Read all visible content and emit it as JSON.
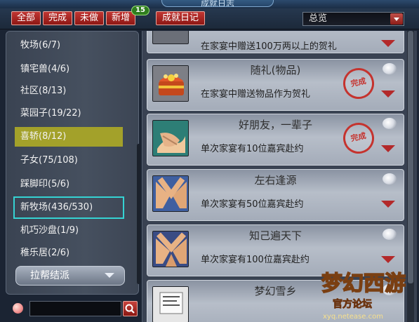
{
  "window": {
    "title": "成就日志"
  },
  "toolbar": {
    "all": "全部",
    "done": "完成",
    "undone": "未做",
    "new": "新增",
    "new_count": "15",
    "log": "成就日记",
    "overview_value": "总览"
  },
  "sidebar": {
    "items": [
      {
        "label": "牧场(6/7)"
      },
      {
        "label": "镇宅兽(4/6)"
      },
      {
        "label": "社区(8/13)"
      },
      {
        "label": "菜园子(19/22)"
      },
      {
        "label": "喜轿(8/12)"
      },
      {
        "label": "子女(75/108)"
      },
      {
        "label": "踩脚印(5/6)"
      },
      {
        "label": "新牧场(436/530)"
      },
      {
        "label": "机巧沙盘(1/9)"
      },
      {
        "label": "稚乐居(2/6)"
      }
    ],
    "guild_label": "拉帮结派"
  },
  "search": {
    "placeholder": ""
  },
  "achievements": [
    {
      "title": "",
      "desc": "在家宴中赠送100万两以上的贺礼",
      "completed": false
    },
    {
      "title": "随礼(物品)",
      "desc": "在家宴中赠送物品作为贺礼",
      "completed": true,
      "seal": "完成"
    },
    {
      "title": "好朋友，一辈子",
      "desc": "单次家宴有10位嘉宾赴约",
      "completed": true,
      "seal": "完成"
    },
    {
      "title": "左右逢源",
      "desc": "单次家宴有50位嘉宾赴约",
      "completed": false
    },
    {
      "title": "知己遍天下",
      "desc": "单次家宴有100位嘉宾赴约",
      "completed": false
    },
    {
      "title": "梦幻雪乡",
      "desc": "",
      "completed": false
    }
  ],
  "watermark": {
    "text": "梦幻西游",
    "sub": "官方论坛",
    "url": "xyq.netease.com"
  },
  "colors": {
    "accent_red": "#b3292a",
    "selected": "#a3a12a",
    "highlight_outline": "#35d3d3",
    "badge_green": "#2f7d1e"
  }
}
